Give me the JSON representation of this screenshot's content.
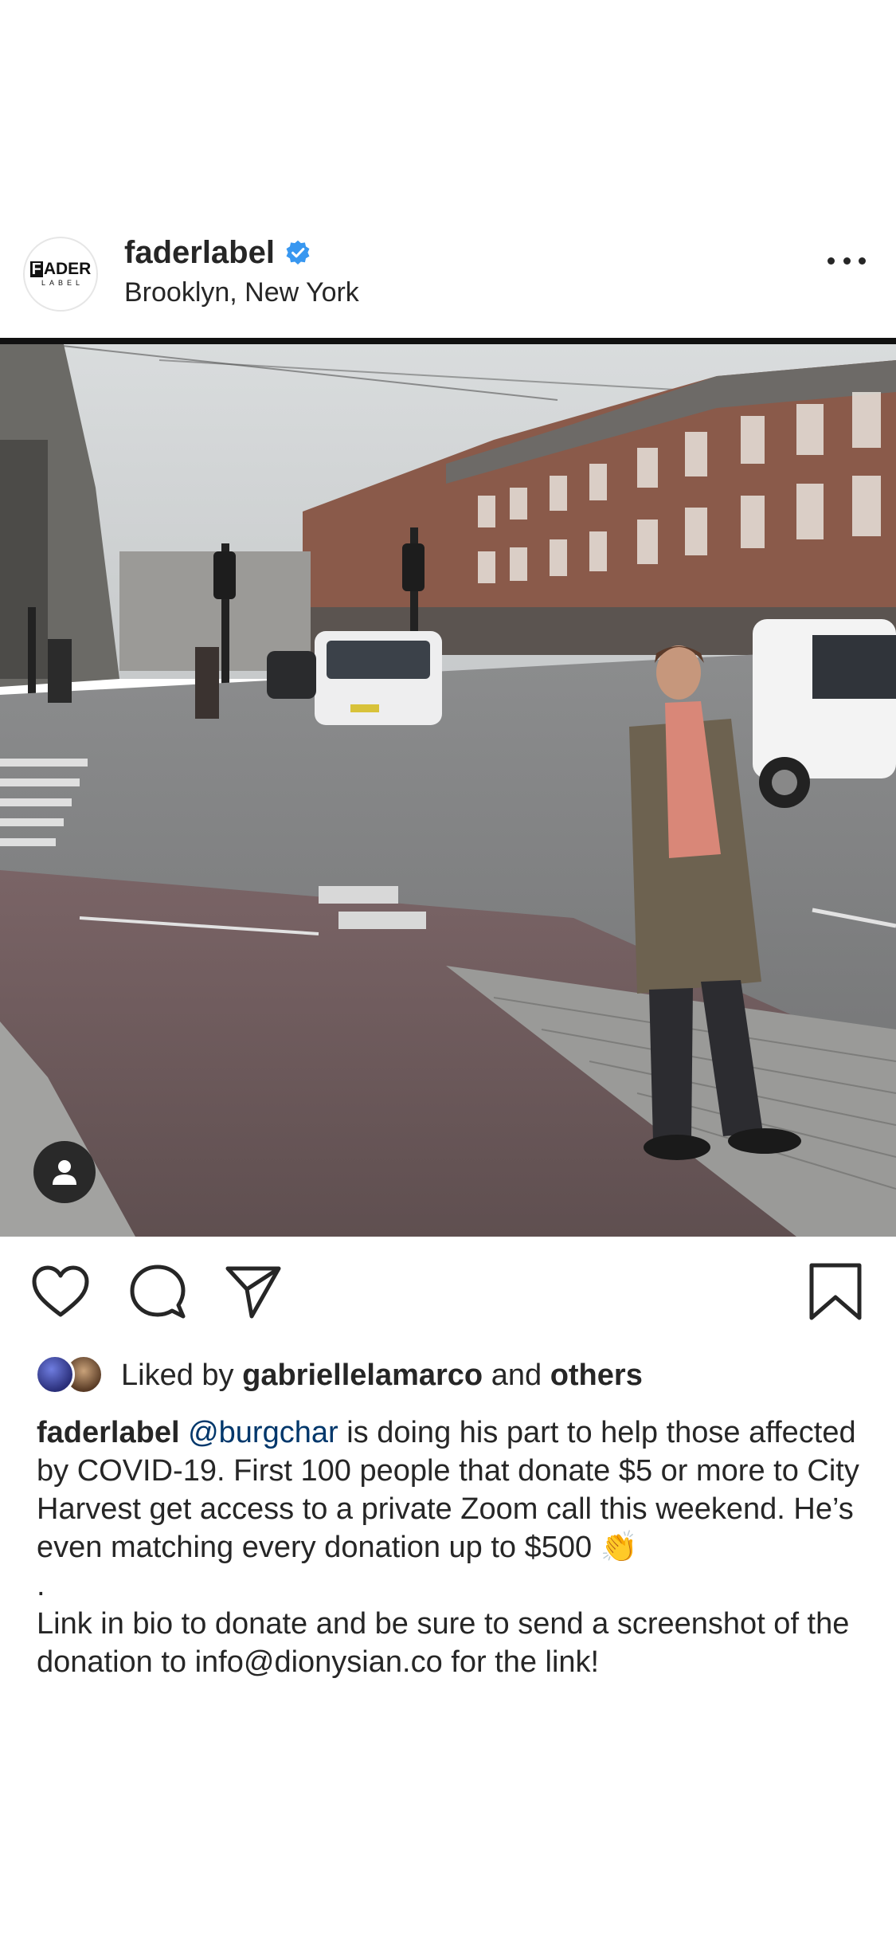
{
  "post": {
    "username": "faderlabel",
    "location": "Brooklyn, New York",
    "avatar_logo_top_initial": "F",
    "avatar_logo_top_rest": "ADER",
    "avatar_logo_bottom": "LABEL",
    "verified": true
  },
  "icons": {
    "verified": "verified-badge-icon",
    "more": "more-options-icon",
    "heart": "heart-icon",
    "comment": "comment-icon",
    "share": "share-icon",
    "save": "bookmark-icon",
    "tag": "user-tag-icon"
  },
  "colors": {
    "verified_blue": "#3897f0",
    "mention_link": "#00376b",
    "text": "#262626"
  },
  "likes": {
    "prefix": "Liked by",
    "user": "gabriellelamarco",
    "joiner": "and",
    "others": "others"
  },
  "caption": {
    "username": "faderlabel",
    "mention": "@burgchar",
    "text": "is doing his part to help those affected by COVID-19. First 100 people that donate $5 or more to City Harvest get access to a private Zoom call this weekend. He’s even matching every donation up to $500 👏",
    "separator": ".",
    "second_paragraph": "Link in bio to donate and be sure to send a screenshot of the donation to info@dionysian.co for the link!"
  }
}
